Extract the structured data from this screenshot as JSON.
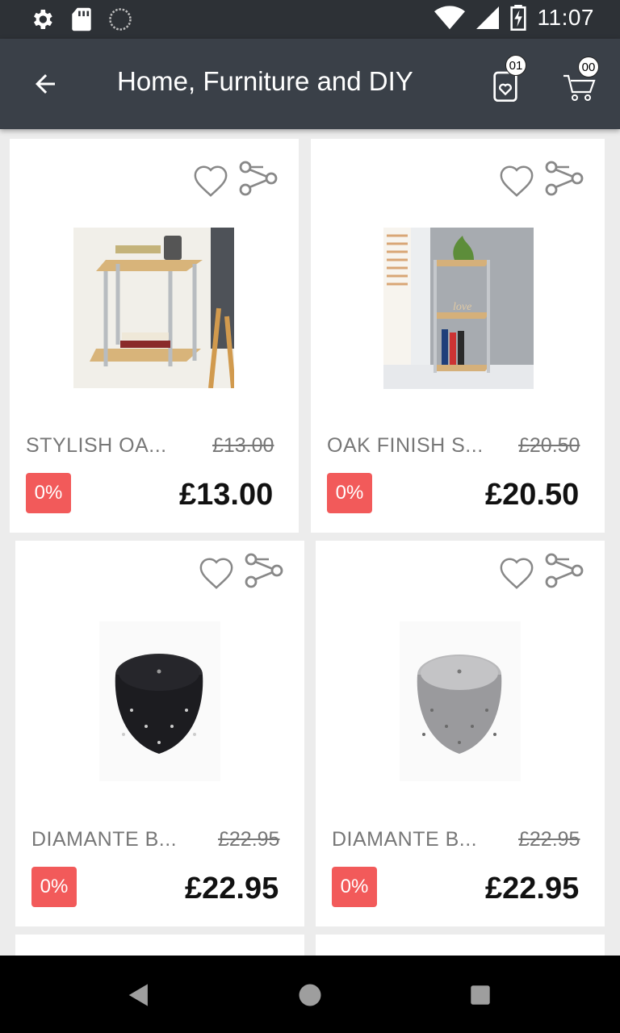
{
  "status_bar": {
    "time": "11:07"
  },
  "app_bar": {
    "title": "Home, Furniture and DIY",
    "wishlist_badge": "01",
    "cart_badge": "00"
  },
  "products": [
    {
      "name": "STYLISH OA...",
      "old_price": "£13.00",
      "discount": "0%",
      "price": "£13.00",
      "image": "oak-side-table"
    },
    {
      "name": "OAK FINISH S...",
      "old_price": "£20.50",
      "discount": "0%",
      "price": "£20.50",
      "image": "oak-corner-shelf"
    },
    {
      "name": "DIAMANTE B...",
      "old_price": "£22.95",
      "discount": "0%",
      "price": "£22.95",
      "image": "black-pouffe"
    },
    {
      "name": "DIAMANTE B...",
      "old_price": "£22.95",
      "discount": "0%",
      "price": "£22.95",
      "image": "silver-pouffe"
    }
  ],
  "colors": {
    "status_bar": "#2d3136",
    "app_bar": "#3a4048",
    "discount": "#f25a5a"
  },
  "icons": [
    "settings-icon",
    "sd-card-icon",
    "sync-icon",
    "wifi-icon",
    "signal-icon",
    "battery-icon",
    "back-arrow-icon",
    "wishlist-icon",
    "cart-icon",
    "heart-icon",
    "share-icon",
    "nav-back-icon",
    "nav-home-icon",
    "nav-recents-icon"
  ]
}
